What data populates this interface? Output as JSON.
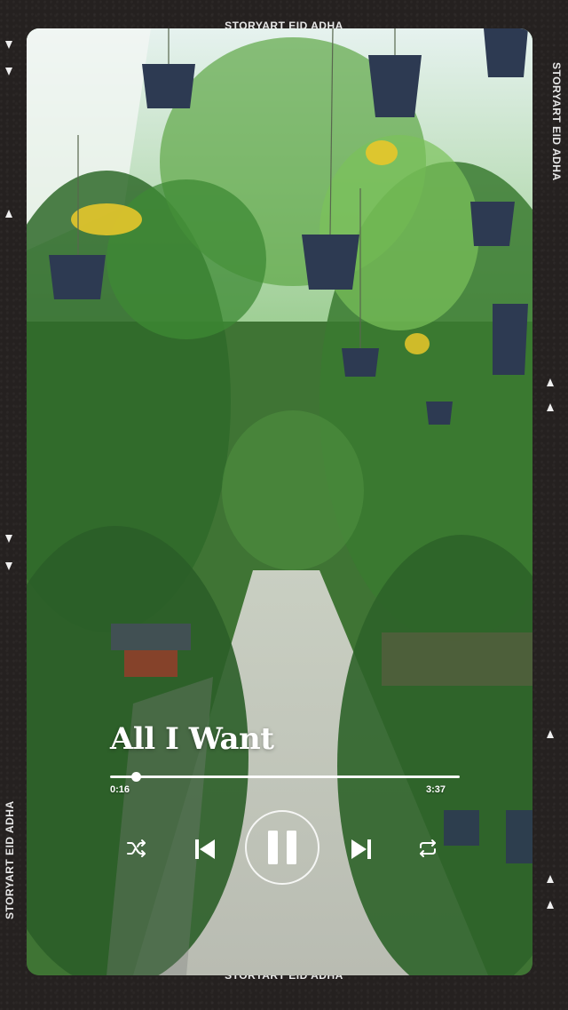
{
  "frame": {
    "caption_top": "STORYART  EID ADHA",
    "caption_bottom": "STORYART  EID ADHA",
    "caption_right": "STORYART  EID ADHA",
    "caption_left": "STORYART  EID ADHA"
  },
  "player": {
    "title": "All I Want",
    "elapsed": "0:16",
    "total": "3:37",
    "progress_fraction": 0.074
  },
  "icons": {
    "shuffle": "shuffle-icon",
    "previous": "skip-previous-icon",
    "pause": "pause-icon",
    "next": "skip-next-icon",
    "repeat": "repeat-icon"
  },
  "colors": {
    "frame": "#252120",
    "text": "#ffffff"
  }
}
